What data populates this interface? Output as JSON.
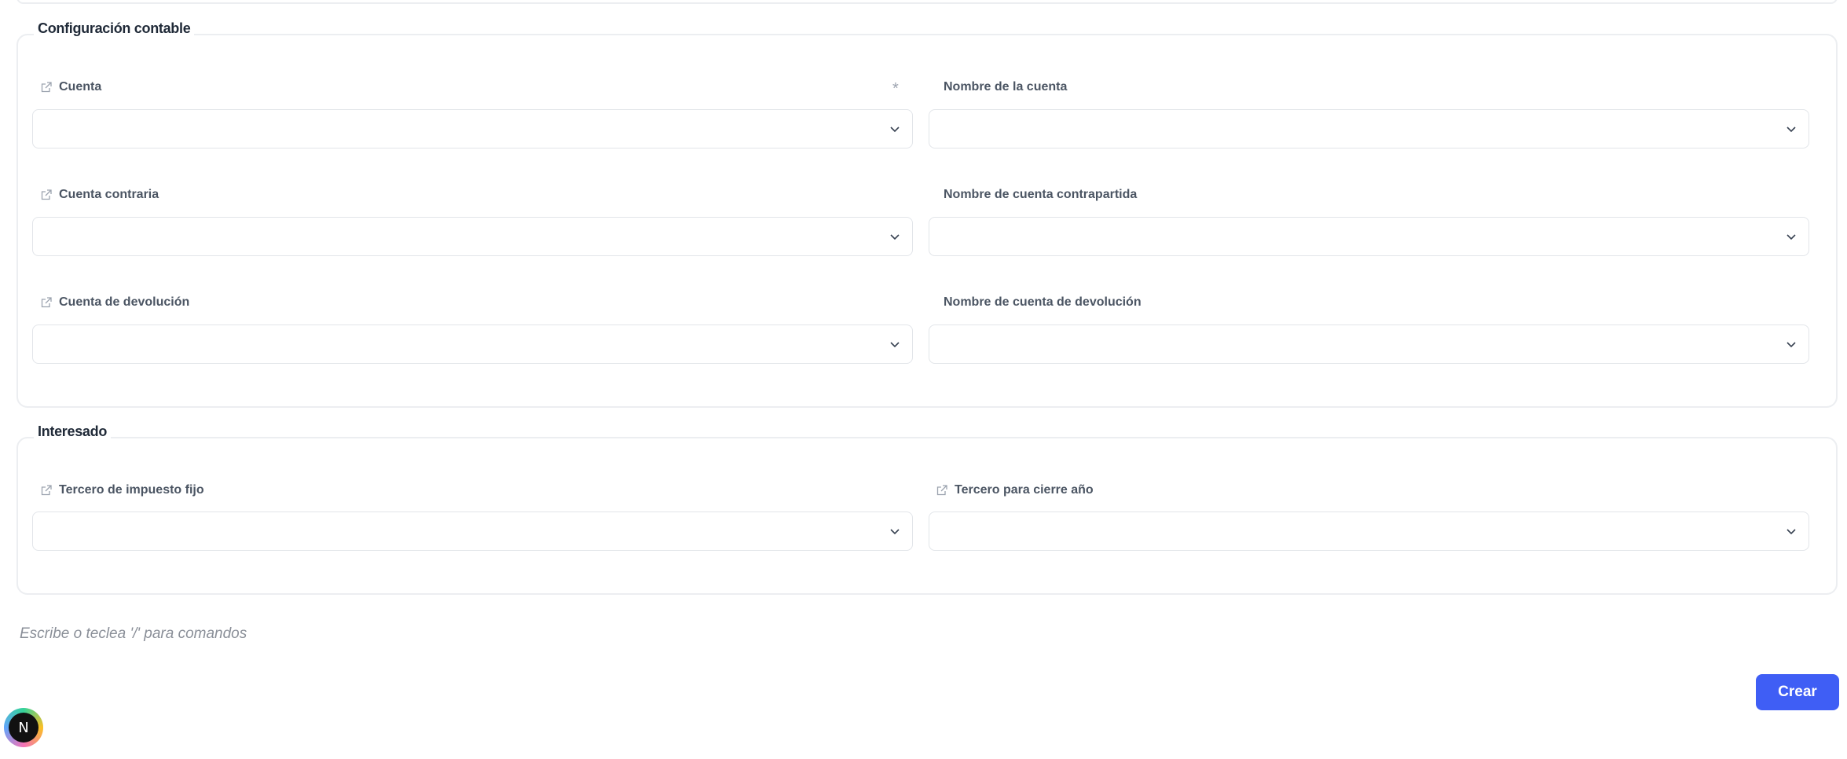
{
  "accounting": {
    "title": "Configuración contable",
    "fields": {
      "account": {
        "label": "Cuenta",
        "required_mark": "*",
        "value": ""
      },
      "account_name": {
        "label": "Nombre de la cuenta",
        "value": ""
      },
      "contra_account": {
        "label": "Cuenta contraria",
        "value": ""
      },
      "contra_account_name": {
        "label": "Nombre de cuenta contrapartida",
        "value": ""
      },
      "refund_account": {
        "label": "Cuenta de devolución",
        "value": ""
      },
      "refund_account_name": {
        "label": "Nombre de cuenta de devolución",
        "value": ""
      }
    }
  },
  "interested": {
    "title": "Interesado",
    "fields": {
      "fixed_tax_third": {
        "label": "Tercero de impuesto fijo",
        "value": ""
      },
      "year_close_third": {
        "label": "Tercero para cierre año",
        "value": ""
      }
    }
  },
  "editor": {
    "placeholder": "Escribe o teclea '/' para comandos"
  },
  "actions": {
    "create_label": "Crear"
  },
  "avatar": {
    "initial": "N"
  },
  "colors": {
    "primary": "#3f5ef5",
    "border": "#eceef1",
    "label": "#4b5563"
  },
  "icons": {
    "link": "external-link-icon",
    "select": "chevron-down-icon"
  }
}
